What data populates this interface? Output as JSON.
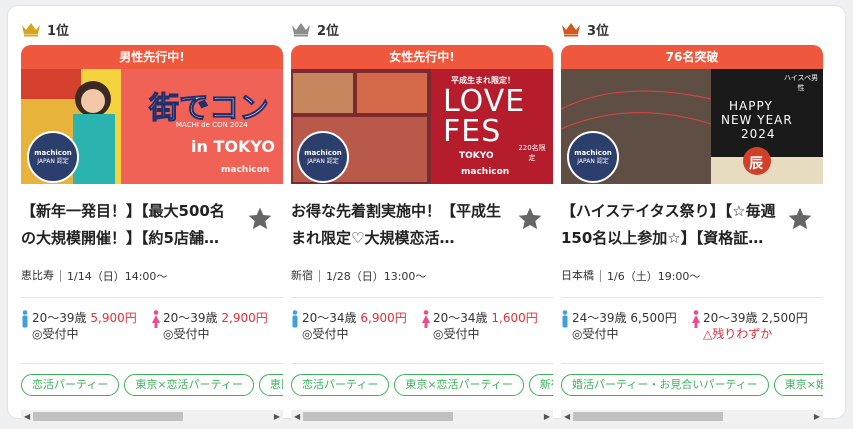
{
  "columns": [
    {
      "rank": "1位",
      "crown_color": "#d6a51a",
      "banner": "男性先行中!",
      "image_text": {
        "big": "街でコン",
        "sub": "MACHI de CON 2024",
        "loc": "in TOKYO",
        "logo": "machicon",
        "badge1": "machicon",
        "badge2": "JAPAN 認定"
      },
      "title": "【新年一発目！】【最大500名の大規模開催！】【約5店舗…",
      "place": "恵比寿",
      "date": "1/14（日）14:00〜",
      "male": {
        "age": "20〜39歳",
        "price": "5,900円",
        "price_red": true,
        "status": "◎受付中",
        "status_red": false
      },
      "female": {
        "age": "20〜39歳",
        "price": "2,900円",
        "price_red": true,
        "status": "◎受付中",
        "status_red": false
      },
      "tags": [
        "恋活パーティー",
        "東京×恋活パーティー",
        "恵比寿×恋活パーティー"
      ]
    },
    {
      "rank": "2位",
      "crown_color": "#8c8c8c",
      "banner": "女性先行中!",
      "image_text": {
        "big1": "LOVE",
        "big2": "FES",
        "top": "平成生まれ限定！",
        "loc": "TOKYO",
        "cap": "220名限定",
        "logo": "machicon",
        "badge1": "machicon",
        "badge2": "JAPAN 認定"
      },
      "title": "お得な先着割実施中！【平成生まれ限定♡大規模恋活…",
      "place": "新宿",
      "date": "1/28（日）13:00〜",
      "male": {
        "age": "20〜34歳",
        "price": "6,900円",
        "price_red": true,
        "status": "◎受付中",
        "status_red": false
      },
      "female": {
        "age": "20〜34歳",
        "price": "1,600円",
        "price_red": true,
        "status": "◎受付中",
        "status_red": false
      },
      "tags": [
        "恋活パーティー",
        "東京×恋活パーティー",
        "新宿×恋活パーティー"
      ]
    },
    {
      "rank": "3位",
      "crown_color": "#d2561e",
      "banner": "76名突破",
      "image_text": {
        "l1": "HAPPY",
        "l2": "NEW YEAR",
        "l3": "2024",
        "corner": "ハイスペ男性",
        "dragon": "辰",
        "badge1": "machicon",
        "badge2": "JAPAN 認定"
      },
      "title": "【ハイステイタス祭り】【☆毎週150名以上参加☆】【資格証…",
      "place": "日本橋",
      "date": "1/6（土）19:00〜",
      "male": {
        "age": "24〜39歳",
        "price": "6,500円",
        "price_red": false,
        "status": "◎受付中",
        "status_red": false
      },
      "female": {
        "age": "20〜39歳",
        "price": "2,500円",
        "price_red": false,
        "status": "△残りわずか",
        "status_red": true
      },
      "tags": [
        "婚活パーティー・お見合いパーティー",
        "東京×婚活パーティー"
      ]
    }
  ]
}
